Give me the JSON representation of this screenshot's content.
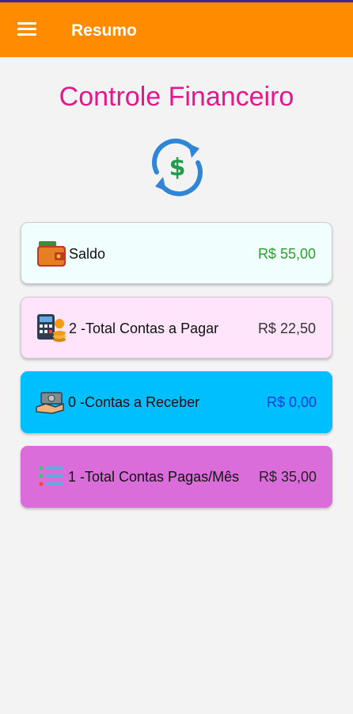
{
  "appbar": {
    "title": "Resumo",
    "color": "#ff8c00",
    "menu_icon": "hamburger-menu-icon"
  },
  "header": {
    "title": "Controle Financeiro",
    "title_color": "#e6178d",
    "logo_icon": "dollar-refresh-icon",
    "logo_symbol": "$"
  },
  "cards": [
    {
      "label": "Saldo",
      "value": "R$ 55,00",
      "value_color": "#2e9e2e",
      "background": "#f0fffd",
      "icon": "wallet-icon"
    },
    {
      "label": "2 -Total Contas a Pagar",
      "value": "R$ 22,50",
      "value_color": "#333333",
      "background": "#ffe4fb",
      "icon": "calculator-coins-icon"
    },
    {
      "label": "0 -Contas a Receber",
      "value": "R$ 0,00",
      "value_color": "#1a3ae0",
      "background": "#00bfff",
      "icon": "hand-money-icon"
    },
    {
      "label": "1 -Total Contas Pagas/Mês",
      "value": "R$ 35,00",
      "value_color": "#222222",
      "background": "#db6dda",
      "icon": "checklist-icon"
    }
  ]
}
